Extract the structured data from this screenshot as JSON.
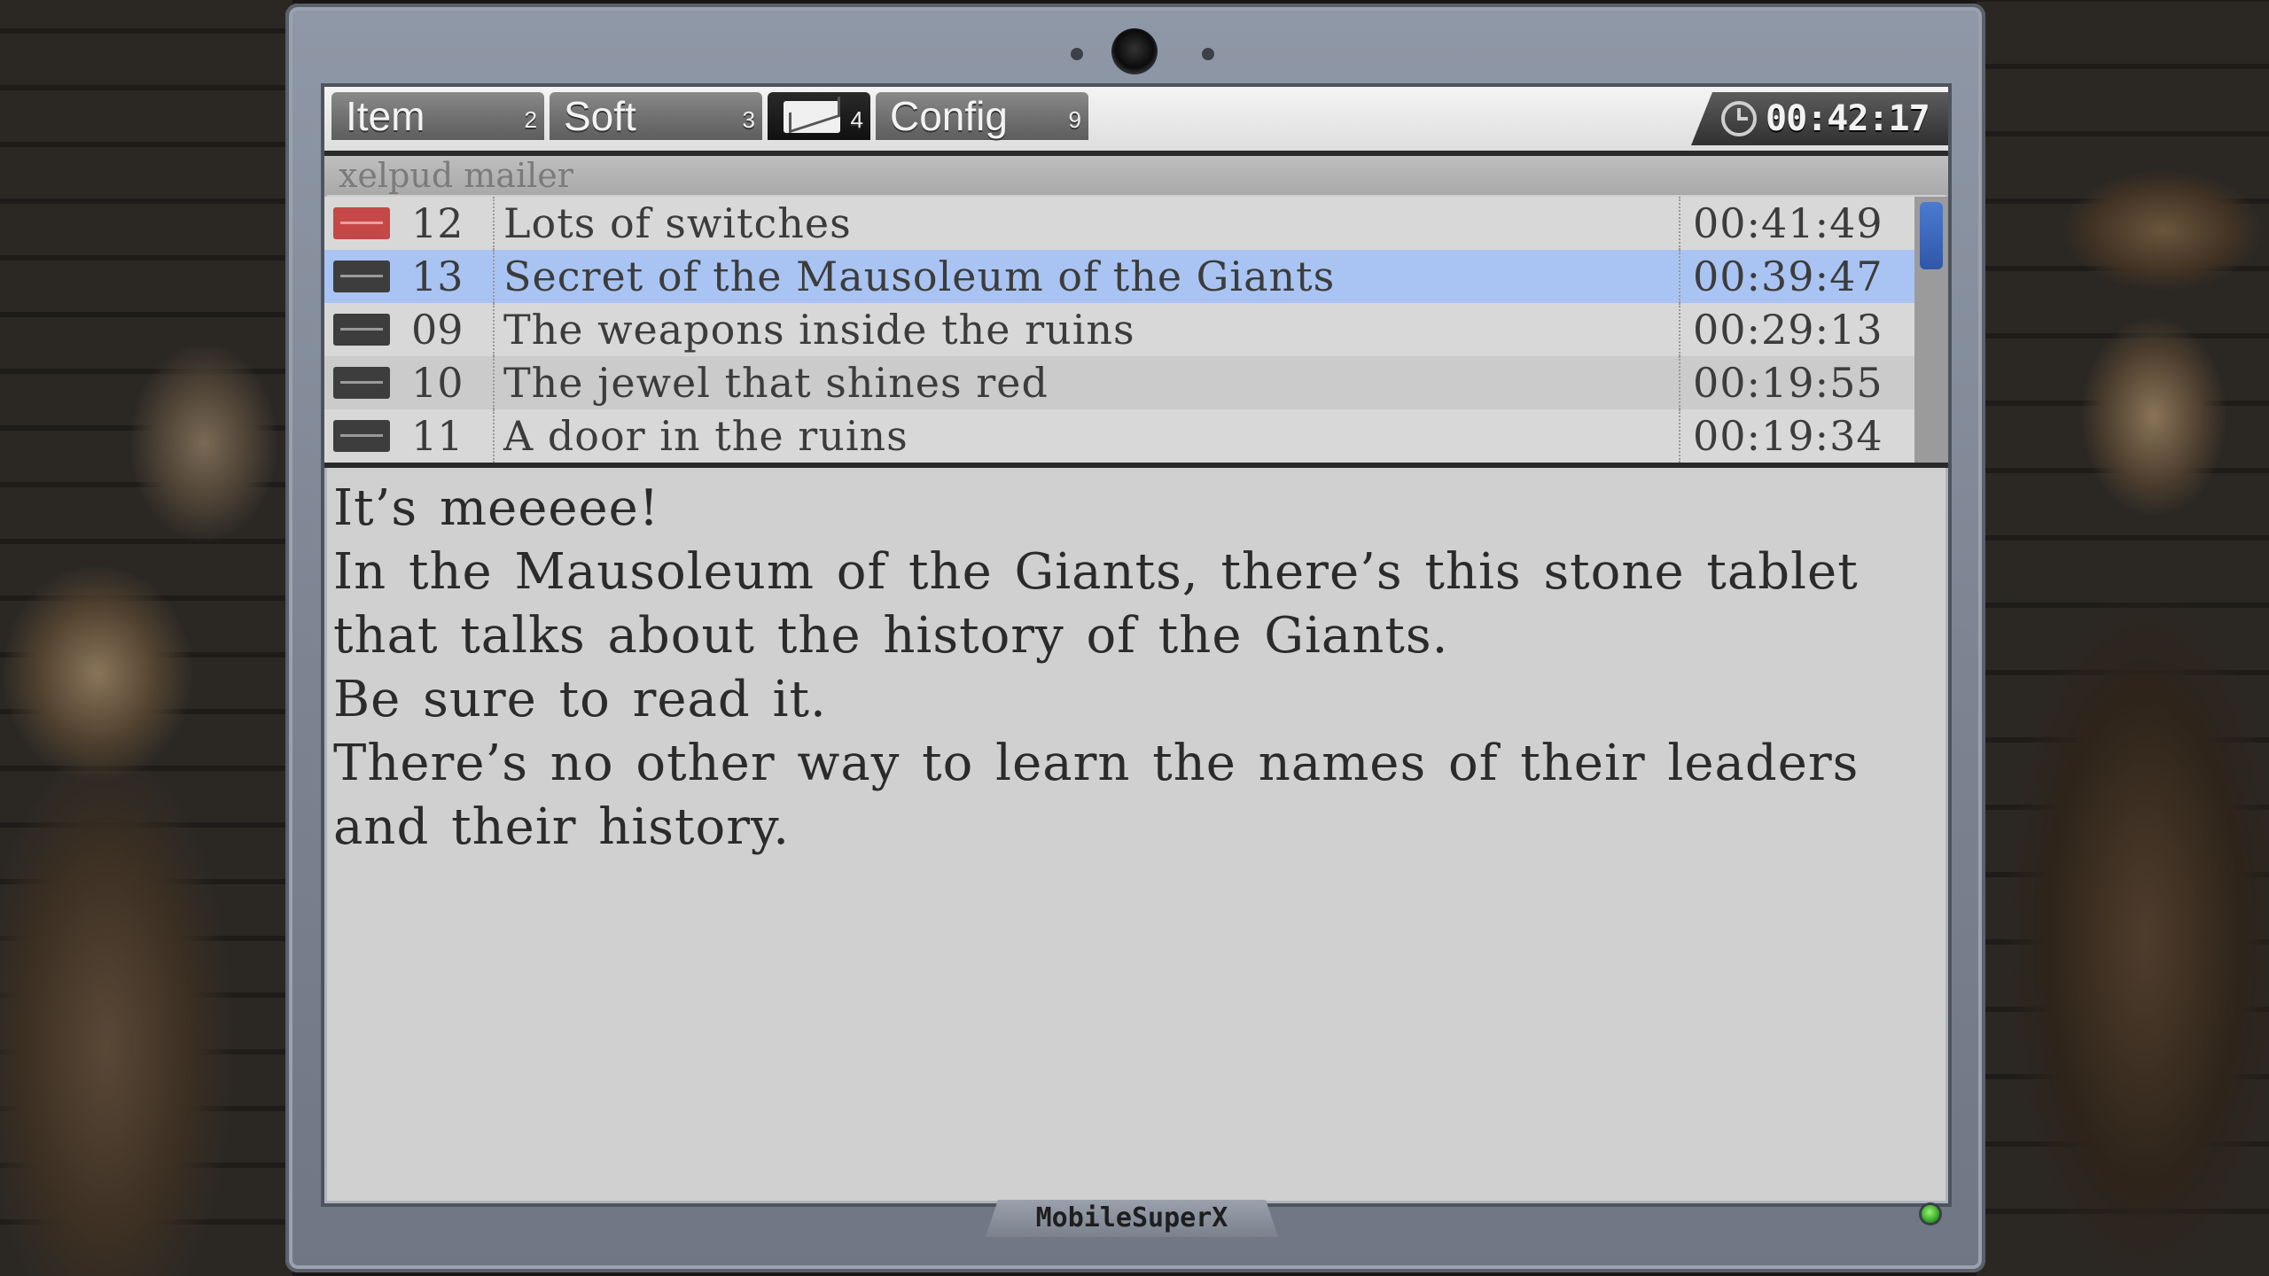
{
  "tabs": [
    {
      "label": "Item",
      "num": "2"
    },
    {
      "label": "Soft",
      "num": "3"
    },
    {
      "label": "",
      "num": "4",
      "icon": "envelope-icon",
      "active": true
    },
    {
      "label": "Config",
      "num": "9"
    }
  ],
  "clock": {
    "time": "00:42:17",
    "icon": "clock-icon"
  },
  "mailer": {
    "title": "xelpud mailer"
  },
  "mails": [
    {
      "num": "12",
      "subject": "Lots of switches",
      "time": "00:41:49",
      "unread": true
    },
    {
      "num": "13",
      "subject": "Secret of the Mausoleum of the Giants",
      "time": "00:39:47",
      "selected": true
    },
    {
      "num": "09",
      "subject": "The weapons inside the ruins",
      "time": "00:29:13"
    },
    {
      "num": "10",
      "subject": "The jewel that shines red",
      "time": "00:19:55"
    },
    {
      "num": "11",
      "subject": "A door in the ruins",
      "time": "00:19:34"
    }
  ],
  "message": {
    "lines": [
      "It’s meeeee!",
      "In the Mausoleum of the Giants, there’s this stone tablet that talks about the history of the Giants.",
      "Be sure to read it.",
      "There’s no other way to learn the names of their leaders and their history."
    ]
  },
  "device": {
    "brand": "MobileSuperX"
  },
  "colors": {
    "selected_row": "#a9c4f2",
    "unread_envelope": "#c54747",
    "scroll_thumb": "#2f57a8",
    "led": "#3fb12a"
  }
}
